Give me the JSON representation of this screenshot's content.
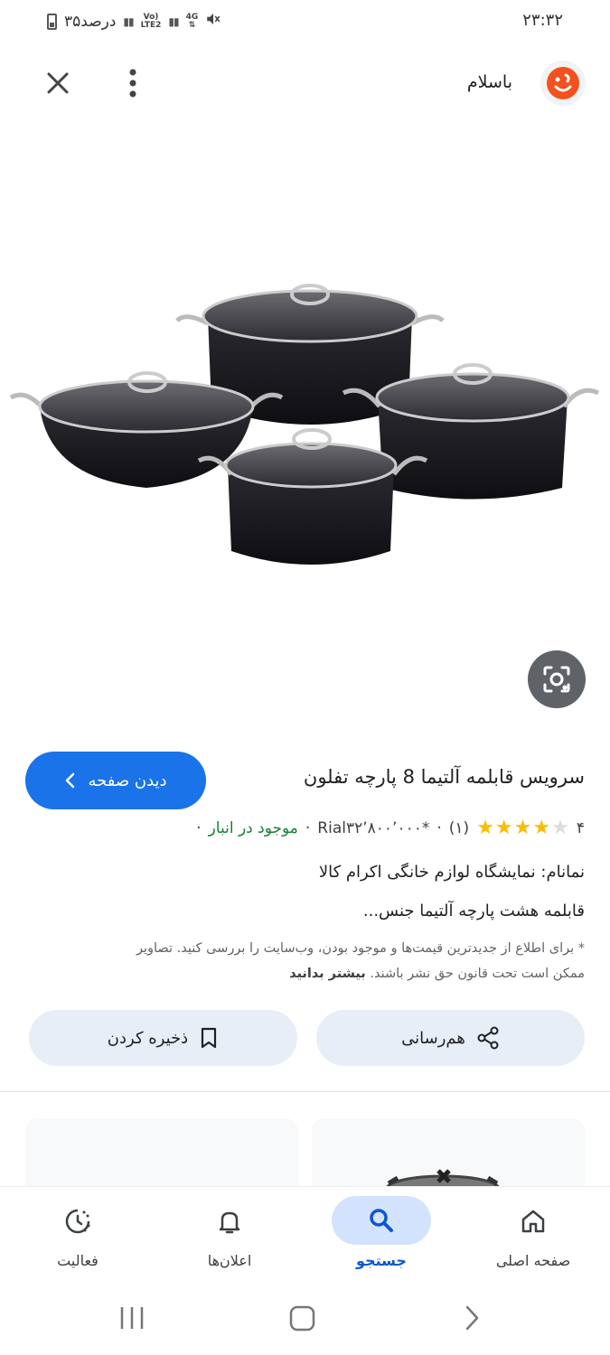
{
  "status_bar": {
    "time": "۲۳:۳۲",
    "battery_text": "۳۵درصد",
    "network_volte": "Vo)",
    "network_lte": "LTE2",
    "network_4g": "4G"
  },
  "top_bar": {
    "site_name": "باسلام",
    "close_icon": "close-icon",
    "menu_icon": "more-vert-icon"
  },
  "product": {
    "title": "سرویس قابلمه آلتیما 8 پارچه تفلون",
    "visit_button": "دیدن صفحه",
    "rating": "۴",
    "stars_filled": 4,
    "stars_total": 5,
    "reviews": "(۱)",
    "separator": "·",
    "price": "Rial۳۲٬۸۰۰٬۰۰۰*",
    "stock": "موجود در انبار",
    "seller": "نمانام: نمایشگاه لوازم خانگی اکرام کالا",
    "description": "قابلمه هشت پارچه آلتیما جنس...",
    "disclaimer_text": "* برای اطلاع از جدیدترین قیمت‌ها و موجود بودن، وب‌سایت را بررسی کنید. تصاویر ممکن است تحت قانون حق نشر باشند.",
    "learn_more": "بیشتر بدانید"
  },
  "actions": {
    "share_label": "هم‌رسانی",
    "save_label": "ذخیره کردن"
  },
  "bottom_nav": {
    "items": [
      {
        "label": "صفحه اصلی",
        "icon": "home-icon"
      },
      {
        "label": "جستجو",
        "icon": "search-icon",
        "active": true
      },
      {
        "label": "اعلان‌ها",
        "icon": "bell-icon"
      },
      {
        "label": "فعالیت",
        "icon": "activity-icon"
      }
    ]
  },
  "colors": {
    "accent": "#1a73e8",
    "stock_green": "#188038",
    "star": "#fbbc04",
    "pill_bg": "#e8eef8",
    "logo_orange": "#f4511e"
  }
}
